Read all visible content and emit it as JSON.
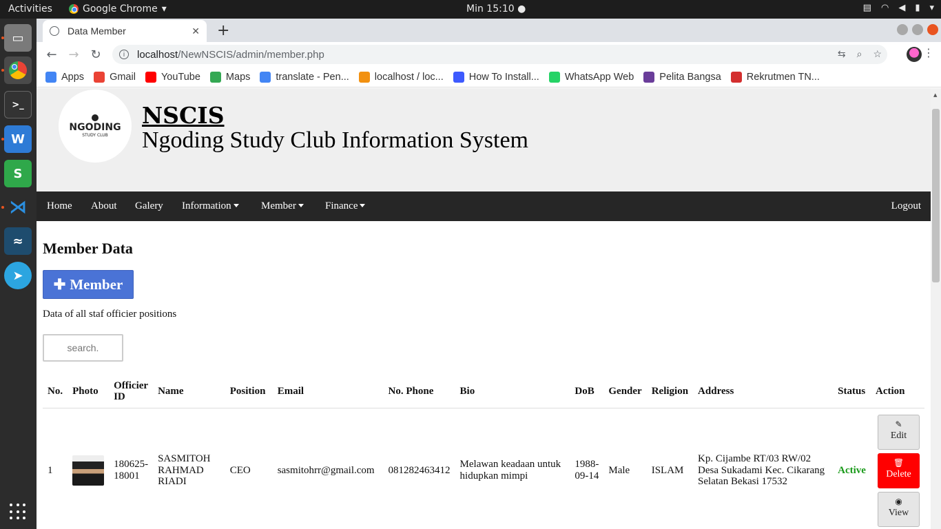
{
  "system": {
    "activities": "Activities",
    "app_name": "Google Chrome",
    "clock": "Min 15:10"
  },
  "browser": {
    "tab_title": "Data Member",
    "url_host": "localhost",
    "url_path": "/NewNSCIS/admin/member.php",
    "bookmarks": [
      "Apps",
      "Gmail",
      "YouTube",
      "Maps",
      "translate - Pen...",
      "localhost / loc...",
      "How To Install...",
      "WhatsApp Web",
      "Pelita Bangsa",
      "Rekrutmen TN..."
    ],
    "bookmark_colors": [
      "#4285f4",
      "#ea4335",
      "#ff0000",
      "#34a853",
      "#4285f4",
      "#f29111",
      "#3d5afe",
      "#25d366",
      "#6a3d9a",
      "#d32f2f"
    ]
  },
  "site": {
    "logo_text": "NGODING",
    "logo_sub": "STUDY CLUB",
    "title": "NSCIS",
    "subtitle": "Ngoding Study Club Information System"
  },
  "nav": {
    "home": "Home",
    "about": "About",
    "galery": "Galery",
    "information": "Information",
    "member": "Member",
    "finance": "Finance",
    "logout": "Logout"
  },
  "main": {
    "heading": "Member Data",
    "add_button": "Member",
    "description": "Data of all staf officier positions",
    "search_placeholder": "search."
  },
  "table": {
    "headers": {
      "no": "No.",
      "photo": "Photo",
      "officier_id": "Officier ID",
      "name": "Name",
      "position": "Position",
      "email": "Email",
      "phone": "No. Phone",
      "bio": "Bio",
      "dob": "DoB",
      "gender": "Gender",
      "religion": "Religion",
      "address": "Address",
      "status": "Status",
      "action": "Action"
    },
    "rows": [
      {
        "no": "1",
        "officier_id": "180625-18001",
        "name": "SASMITOH RAHMAD RIADI",
        "position": "CEO",
        "email": "sasmitohrr@gmail.com",
        "phone": "081282463412",
        "bio": "Melawan keadaan untuk hidupkan mimpi",
        "dob": "1988-09-14",
        "gender": "Male",
        "religion": "ISLAM",
        "address": "Kp. Cijambe RT/03 RW/02 Desa Sukadami Kec. Cikarang Selatan Bekasi 17532",
        "status": "Active",
        "edit": "Edit",
        "delete": "Delete",
        "view": "View"
      }
    ]
  }
}
